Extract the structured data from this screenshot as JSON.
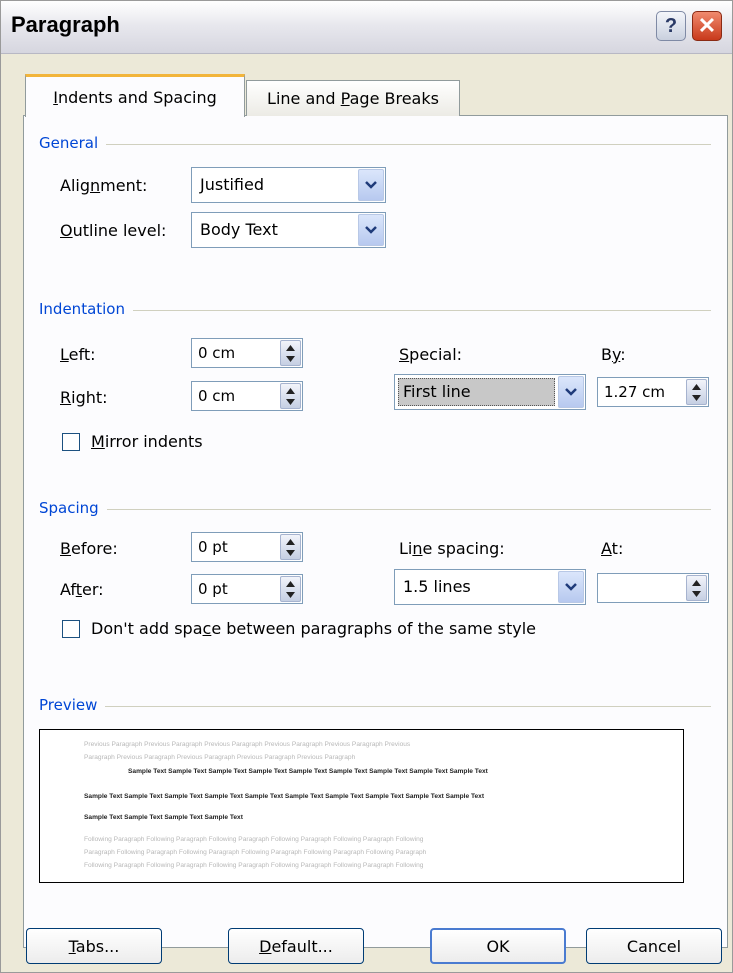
{
  "window": {
    "title": "Paragraph",
    "help_glyph": "?",
    "close_glyph": "✕"
  },
  "tabs": [
    {
      "label_pre": "",
      "label_key": "I",
      "label_post": "ndents and Spacing",
      "active": true
    },
    {
      "label_pre": "Line and ",
      "label_key": "P",
      "label_post": "age Breaks",
      "active": false
    }
  ],
  "general": {
    "title": "General",
    "alignment": {
      "pre": "Alig",
      "key": "n",
      "post": "ment:",
      "value": "Justified"
    },
    "outline": {
      "pre": "",
      "key": "O",
      "post": "utline level:",
      "value": "Body Text"
    }
  },
  "indentation": {
    "title": "Indentation",
    "left": {
      "pre": "",
      "key": "L",
      "post": "eft:",
      "value": "0 cm"
    },
    "right": {
      "pre": "",
      "key": "R",
      "post": "ight:",
      "value": "0 cm"
    },
    "special": {
      "pre": "",
      "key": "S",
      "post": "pecial:",
      "value": "First line"
    },
    "by": {
      "pre": "B",
      "key": "y",
      "post": ":",
      "value": "1.27 cm"
    },
    "mirror": {
      "pre": "",
      "key": "M",
      "post": "irror indents",
      "checked": false
    }
  },
  "spacing": {
    "title": "Spacing",
    "before": {
      "pre": "",
      "key": "B",
      "post": "efore:",
      "value": "0 pt"
    },
    "after": {
      "pre": "Af",
      "key": "t",
      "post": "er:",
      "value": "0 pt"
    },
    "line_spacing": {
      "pre": "Li",
      "key": "n",
      "post": "e spacing:",
      "value": "1.5 lines"
    },
    "at": {
      "pre": "",
      "key": "A",
      "post": "t:",
      "value": ""
    },
    "dont_add": {
      "pre": "Don't add spa",
      "key": "c",
      "post": "e between paragraphs of the same style",
      "checked": false
    }
  },
  "preview": {
    "title": "Preview",
    "previous_1": "Previous Paragraph Previous Paragraph Previous Paragraph Previous Paragraph Previous Paragraph Previous",
    "previous_2": "Paragraph Previous Paragraph Previous Paragraph Previous Paragraph Previous Paragraph",
    "sample_1": "Sample Text Sample Text Sample Text Sample Text Sample Text Sample Text Sample Text Sample Text Sample Text",
    "sample_2": "Sample Text Sample Text Sample Text Sample Text Sample Text Sample Text Sample Text Sample Text Sample Text Sample Text",
    "sample_3": "Sample Text Sample Text Sample Text Sample Text",
    "following_1": "Following Paragraph Following Paragraph Following Paragraph Following Paragraph Following Paragraph Following",
    "following_2": "Paragraph Following Paragraph Following Paragraph Following Paragraph Following Paragraph Following Paragraph",
    "following_3": "Following Paragraph Following Paragraph Following Paragraph Following Paragraph Following Paragraph Following"
  },
  "buttons": {
    "tabs": {
      "pre": "",
      "key": "T",
      "post": "abs..."
    },
    "default": {
      "pre": "",
      "key": "D",
      "post": "efault..."
    },
    "ok": "OK",
    "cancel": "Cancel"
  },
  "colors": {
    "accent": "#0046d5",
    "tab_highlight": "#f2b53b",
    "close": "#c8391b"
  }
}
